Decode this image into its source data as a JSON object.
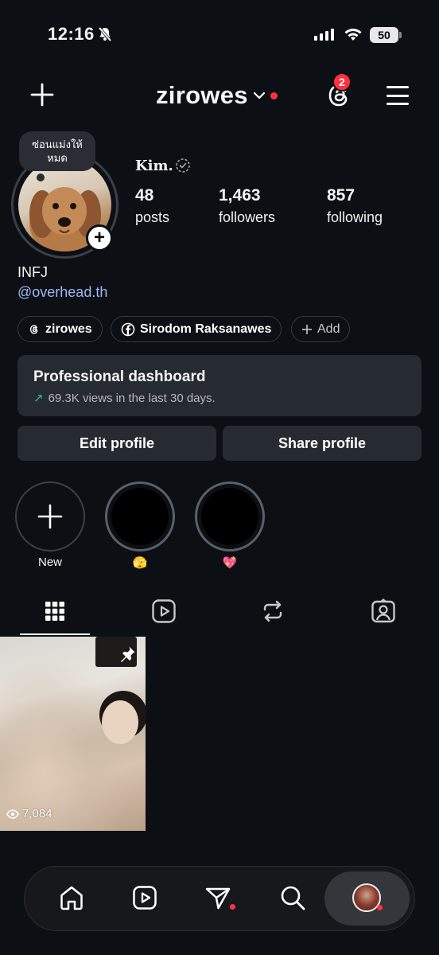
{
  "status_bar": {
    "time": "12:16",
    "battery": "50",
    "icons": [
      "bell-slash-icon",
      "cellular-signal-icon",
      "wifi-icon",
      "battery-icon"
    ]
  },
  "header": {
    "username": "zirowes",
    "threads_badge_count": "2",
    "icons": [
      "plus-icon",
      "chevron-down-icon",
      "threads-icon",
      "hamburger-menu-icon"
    ]
  },
  "profile": {
    "note": "ซ่อนแม่งให้หมด",
    "display_name": "Kim.",
    "stats": [
      {
        "value": "48",
        "label": "posts"
      },
      {
        "value": "1,463",
        "label": "followers"
      },
      {
        "value": "857",
        "label": "following"
      }
    ],
    "bio": "INFJ",
    "link": "@overhead.th"
  },
  "chips": [
    {
      "label": "zirowes",
      "icon": "threads-icon"
    },
    {
      "label": "Sirodom Raksanawes",
      "icon": "facebook-icon"
    },
    {
      "label": "Add",
      "icon": "plus-icon"
    }
  ],
  "dashboard": {
    "title": "Professional dashboard",
    "subtitle": "69.3K views in the last 30 days."
  },
  "buttons": {
    "edit": "Edit profile",
    "share": "Share profile"
  },
  "highlights": [
    {
      "label": "New"
    },
    {
      "label": "🫣"
    },
    {
      "label": "💖"
    }
  ],
  "tabs": [
    "grid-icon",
    "reels-icon",
    "reposts-icon",
    "tagged-icon"
  ],
  "posts": [
    {
      "views": "7,084",
      "pinned": true
    }
  ],
  "bottom_nav": [
    "home-icon",
    "reels-icon",
    "direct-icon",
    "search-icon",
    "profile-avatar"
  ],
  "colors": {
    "background": "#0c0f14",
    "accent_red": "#ff3040",
    "link": "#a3b8f5",
    "card": "#262a31"
  }
}
